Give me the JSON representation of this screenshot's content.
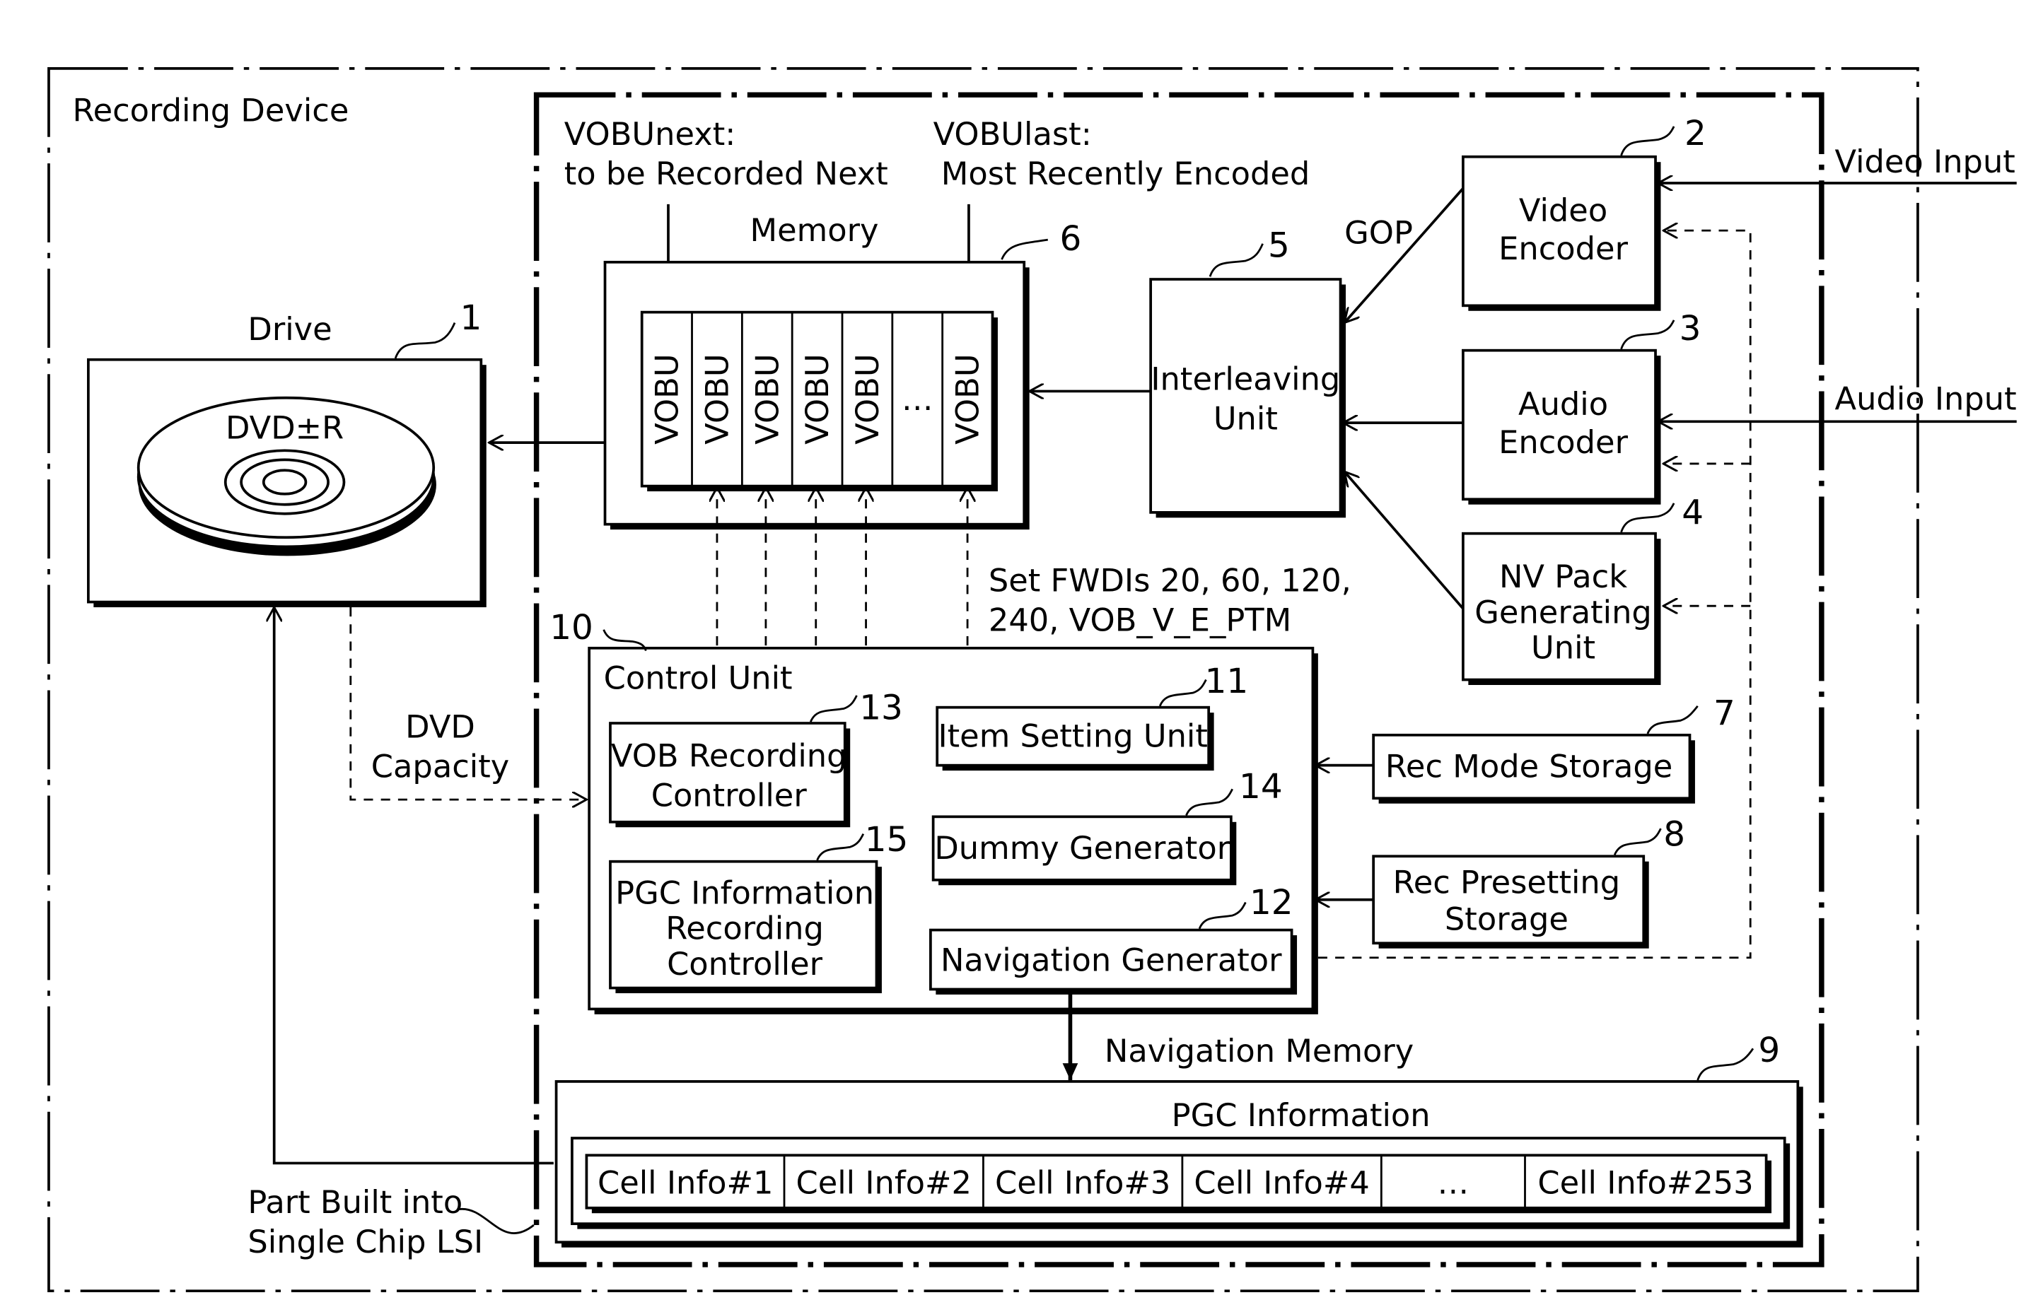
{
  "figure": {
    "outer_label": "Recording Device",
    "lsi_label_line1": "Part Built into",
    "lsi_label_line2": "Single Chip LSI",
    "vobu_next_line1": "VOBUnext:",
    "vobu_next_line2": "to be Recorded Next",
    "vobu_last_line1": "VOBUlast:",
    "vobu_last_line2": "Most Recently Encoded",
    "memory_label": "Memory",
    "memory_ref": "6",
    "vobu_cells": [
      "VOBU",
      "VOBU",
      "VOBU",
      "VOBU",
      "VOBU",
      "…",
      "VOBU"
    ],
    "drive_label": "Drive",
    "drive_ref": "1",
    "disc_label": "DVD±R",
    "interleaving_line1": "Interleaving",
    "interleaving_line2": "Unit",
    "interleaving_ref": "5",
    "gop_label": "GOP",
    "video_encoder_line1": "Video",
    "video_encoder_line2": "Encoder",
    "video_encoder_ref": "2",
    "audio_encoder_line1": "Audio",
    "audio_encoder_line2": "Encoder",
    "audio_encoder_ref": "3",
    "nv_pack_line1": "NV Pack",
    "nv_pack_line2": "Generating",
    "nv_pack_line3": "Unit",
    "nv_pack_ref": "4",
    "video_input": "Video Input",
    "audio_input": "Audio Input",
    "fwdi_line1": "Set FWDIs 20, 60, 120,",
    "fwdi_line2": "240, VOB_V_E_PTM",
    "dvd_capacity_line1": "DVD",
    "dvd_capacity_line2": "Capacity",
    "control_unit_label": "Control Unit",
    "control_unit_ref": "10",
    "vob_rec_line1": "VOB Recording",
    "vob_rec_line2": "Controller",
    "vob_rec_ref": "13",
    "item_setting": "Item Setting Unit",
    "item_setting_ref": "11",
    "dummy_gen": "Dummy Generator",
    "dummy_gen_ref": "14",
    "pgc_rec_line1": "PGC Information",
    "pgc_rec_line2": "Recording",
    "pgc_rec_line3": "Controller",
    "pgc_rec_ref": "15",
    "nav_gen": "Navigation Generator",
    "nav_gen_ref": "12",
    "rec_mode": "Rec Mode Storage",
    "rec_mode_ref": "7",
    "rec_preset_line1": "Rec Presetting",
    "rec_preset_line2": "Storage",
    "rec_preset_ref": "8",
    "nav_memory_label": "Navigation Memory",
    "nav_memory_ref": "9",
    "pgc_info_label": "PGC Information",
    "cell_infos": [
      "Cell Info#1",
      "Cell Info#2",
      "Cell Info#3",
      "Cell Info#4",
      "…",
      "Cell Info#253"
    ]
  }
}
